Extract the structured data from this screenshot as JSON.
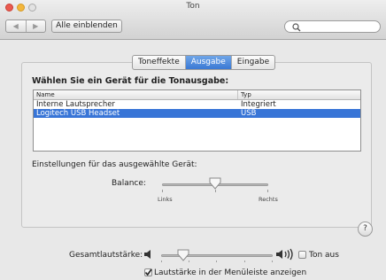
{
  "window": {
    "title": "Ton"
  },
  "toolbar": {
    "nav_back": "◀",
    "nav_forward": "▶",
    "show_all": "Alle einblenden",
    "search_placeholder": ""
  },
  "tabs": [
    {
      "label": "Toneffekte",
      "active": false
    },
    {
      "label": "Ausgabe",
      "active": true
    },
    {
      "label": "Eingabe",
      "active": false
    }
  ],
  "output": {
    "heading": "Wählen Sie ein Gerät für die Tonausgabe:",
    "columns": [
      "Name",
      "Typ"
    ],
    "rows": [
      {
        "name": "Interne Lautsprecher",
        "type": "Integriert",
        "selected": false
      },
      {
        "name": "Logitech USB Headset",
        "type": "USB",
        "selected": true
      }
    ],
    "settings_label": "Einstellungen für das ausgewählte Gerät:",
    "balance": {
      "label": "Balance:",
      "left_label": "Links",
      "right_label": "Rechts",
      "value": 0.5
    }
  },
  "help": "?",
  "footer": {
    "volume_label": "Gesamtlautstärke:",
    "volume_value": 0.2,
    "mute_label": "Ton aus",
    "mute_checked": false,
    "menubar_label": "Lautstärke in der Menüleiste anzeigen",
    "menubar_checked": true
  },
  "colors": {
    "selection": "#3875d7",
    "close": "#ea5a4f",
    "minimize": "#f3b63b"
  }
}
